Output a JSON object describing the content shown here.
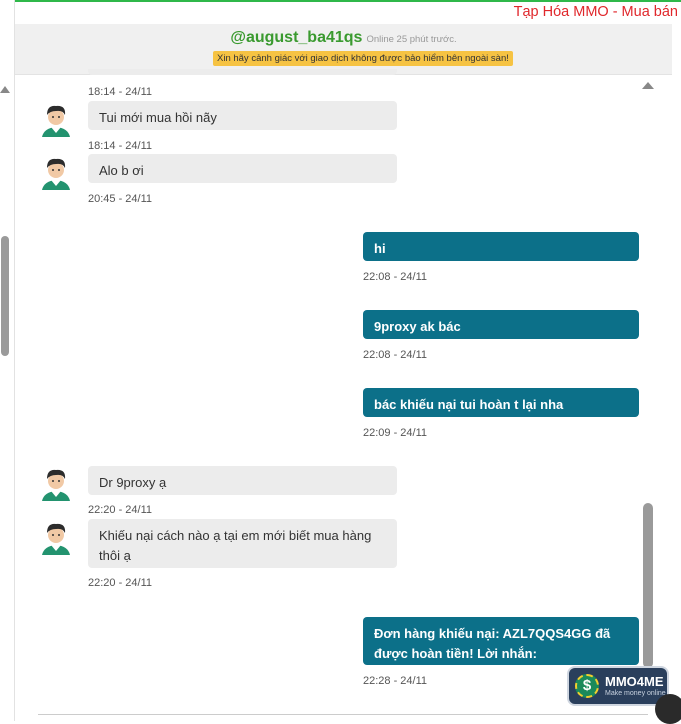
{
  "site": {
    "title": "Tạp Hóa MMO - Mua bán"
  },
  "header": {
    "username": "@august_ba41qs",
    "status": "Online 25 phút trước.",
    "warning": "Xin hãy cảnh giác với giao dịch không được bảo hiểm bên ngoài sàn!"
  },
  "messages": [
    {
      "direction": "in",
      "time": "18:14 - 24/11"
    },
    {
      "direction": "in",
      "text": "Tui mới mua hồi nãy",
      "time": "18:14 - 24/11"
    },
    {
      "direction": "in",
      "text": "Alo b ơi",
      "time": "20:45 - 24/11"
    },
    {
      "direction": "out",
      "text": "hi",
      "time": "22:08 - 24/11"
    },
    {
      "direction": "out",
      "text": "9proxy ak bác",
      "time": "22:08 - 24/11"
    },
    {
      "direction": "out",
      "text": "bác khiếu nại tui hoàn t lại nha",
      "time": "22:09 - 24/11"
    },
    {
      "direction": "in",
      "text": "Dr 9proxy ạ",
      "time": "22:20 - 24/11"
    },
    {
      "direction": "in",
      "text": "Khiếu nại cách nào ạ tại em mới biết mua hàng thôi ạ",
      "time": "22:20 - 24/11"
    },
    {
      "direction": "out",
      "text": "Đơn hàng khiếu nại: AZL7QQS4GG đã được hoàn tiền! Lời nhắn:",
      "time": "22:28 - 24/11"
    }
  ],
  "logo": {
    "symbol": "$",
    "name": "MMO4ME",
    "tagline": "Make money online"
  },
  "icons": {
    "scroll_up": "triangle-up-icon",
    "avatar": "user-avatar-icon"
  },
  "colors": {
    "accent_green": "#3a9a2f",
    "outgoing_bubble": "#0c7089",
    "incoming_bubble": "#ececec",
    "site_title": "#e0272b",
    "warning_bg": "#f6c343"
  }
}
